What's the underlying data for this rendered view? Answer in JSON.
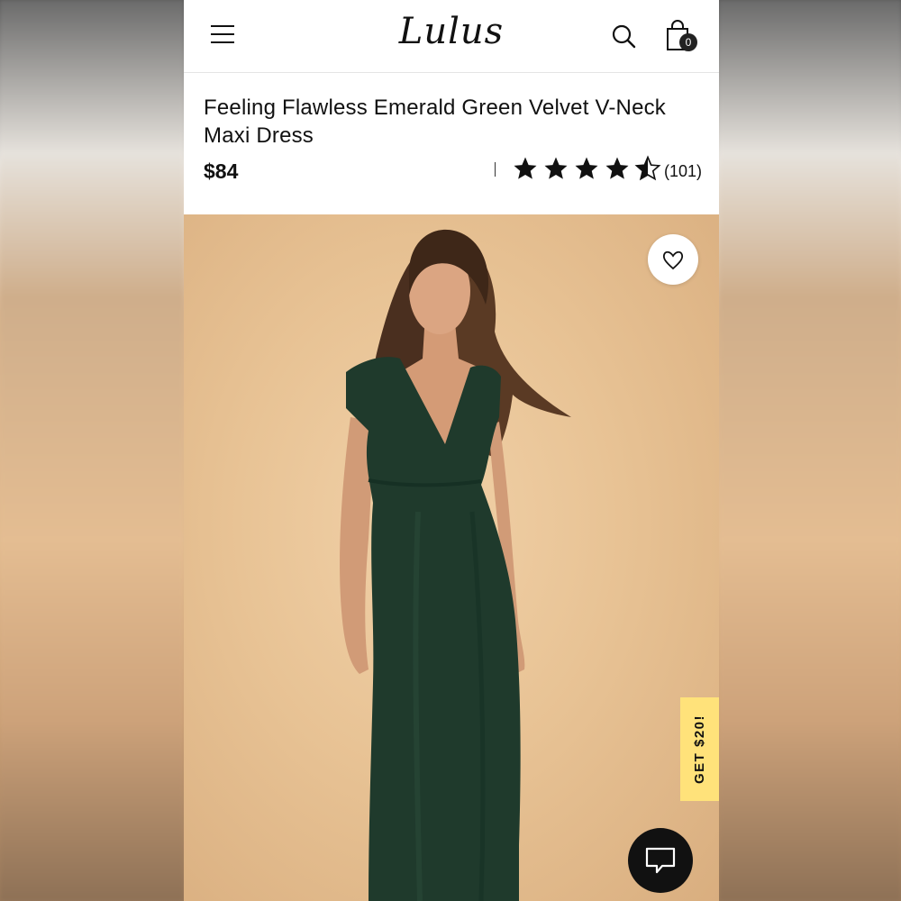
{
  "header": {
    "logo_text": "Lulus",
    "menu_icon": "hamburger-menu-icon",
    "search_icon": "search-icon",
    "bag_icon": "shopping-bag-icon",
    "bag_count": "0"
  },
  "product": {
    "title": "Feeling Flawless Emerald Green Velvet V-Neck Maxi Dress",
    "price": "$84",
    "rating": 4.5,
    "rating_max": 5,
    "review_count": "(101)",
    "image_subject": "Model wearing emerald green velvet V-neck maxi dress",
    "dress_color": "#1f3a2c"
  },
  "actions": {
    "favorite_icon": "heart-icon",
    "promo_label": "GET $20!",
    "chat_icon": "chat-icon"
  },
  "colors": {
    "promo_bg": "#ffe27a",
    "hero_bg": "#e8c395",
    "text": "#111111"
  }
}
